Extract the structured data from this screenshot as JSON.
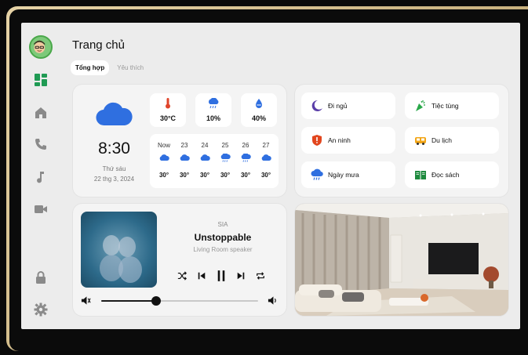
{
  "header": {
    "title": "Trang chủ"
  },
  "tabs": [
    {
      "label": "Tổng hợp",
      "active": true
    },
    {
      "label": "Yêu thích",
      "active": false
    }
  ],
  "sidebar": {
    "items": [
      "dashboard",
      "home",
      "phone",
      "music",
      "camera",
      "lock",
      "settings"
    ]
  },
  "weather": {
    "time": "8:30",
    "day": "Thứ sáu",
    "date": "22 thg 3, 2024",
    "stats": [
      {
        "icon": "thermometer-icon",
        "value": "30°C"
      },
      {
        "icon": "rain-cloud-icon",
        "value": "10%"
      },
      {
        "icon": "droplet-icon",
        "value": "40%"
      }
    ],
    "hourly": [
      {
        "label": "Now",
        "icon": "cloud-icon",
        "temp": "30°"
      },
      {
        "label": "23",
        "icon": "cloud-icon",
        "temp": "30°"
      },
      {
        "label": "24",
        "icon": "cloud-icon",
        "temp": "30°"
      },
      {
        "label": "25",
        "icon": "rain-cloud-icon",
        "temp": "30°"
      },
      {
        "label": "26",
        "icon": "rain-cloud-icon",
        "temp": "30°"
      },
      {
        "label": "27",
        "icon": "cloud-icon",
        "temp": "30°"
      }
    ]
  },
  "scenes": [
    {
      "label": "Đi ngủ",
      "icon": "moon-icon"
    },
    {
      "label": "Tiệc tùng",
      "icon": "party-popper-icon"
    },
    {
      "label": "An ninh",
      "icon": "shield-icon"
    },
    {
      "label": "Du lịch",
      "icon": "bus-icon"
    },
    {
      "label": "Ngày mưa",
      "icon": "rain-cloud-icon"
    },
    {
      "label": "Đọc sách",
      "icon": "book-icon"
    }
  ],
  "player": {
    "artist": "SIA",
    "song": "Unstoppable",
    "device": "Living Room speaker",
    "volume": 0.35
  },
  "colors": {
    "accent": "#2f6fe0",
    "background": "#ececec"
  }
}
